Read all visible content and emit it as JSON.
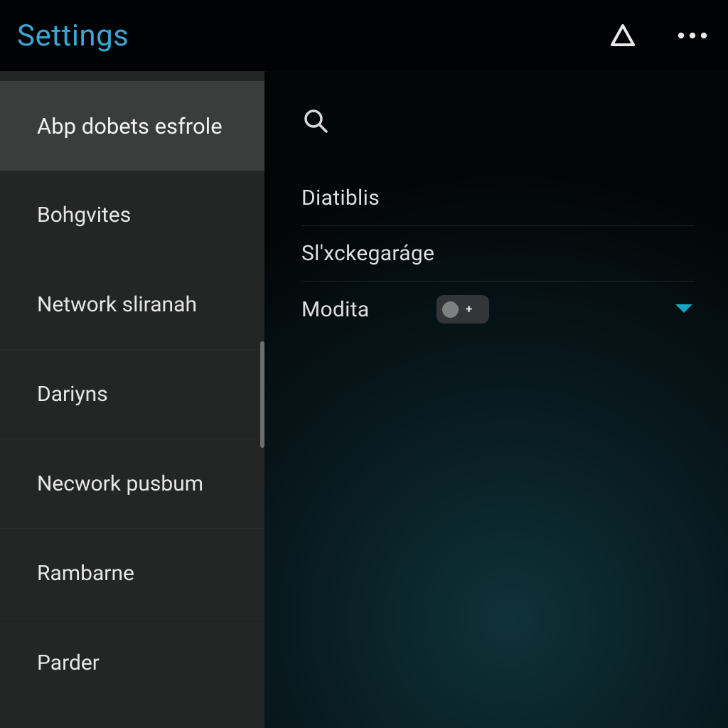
{
  "header": {
    "title": "Settings"
  },
  "sidebar": {
    "items": [
      {
        "label": "Abp dobets esfrole",
        "selected": true
      },
      {
        "label": "Bohgvites",
        "selected": false
      },
      {
        "label": "Network sliranah",
        "selected": false
      },
      {
        "label": "Dariyns",
        "selected": false
      },
      {
        "label": "Necwork pusbum",
        "selected": false
      },
      {
        "label": "Rambarne",
        "selected": false
      },
      {
        "label": "Parder",
        "selected": false
      }
    ]
  },
  "main": {
    "rows": [
      {
        "label": "Diatiblis"
      },
      {
        "label": "Sl'xckegaráge"
      },
      {
        "label": "Modita"
      }
    ],
    "toggle_plus": "+"
  },
  "colors": {
    "accent": "#3aa6d4",
    "dropdown": "#12a5c4"
  }
}
